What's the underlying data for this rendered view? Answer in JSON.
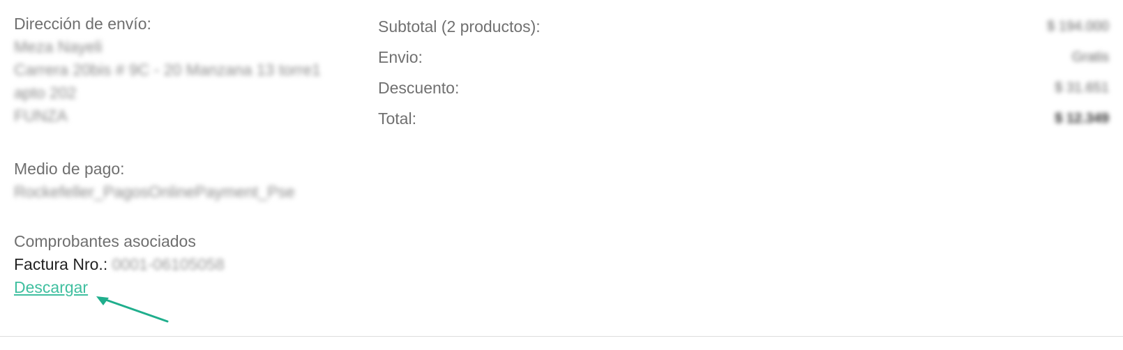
{
  "shipping": {
    "label": "Dirección de envío:",
    "lines": [
      "Meza Nayeli",
      "Carrera 20bis # 9C - 20 Manzana 13 torre1",
      "apto 202",
      "FUNZA"
    ]
  },
  "payment": {
    "label": "Medio de pago:",
    "method": "Rockefeller_PagosOnlinePayment_Pse"
  },
  "vouchers": {
    "label": "Comprobantes asociados",
    "invoice_label": "Factura Nro.:",
    "invoice_number": "0001-06105058",
    "download_label": "Descargar"
  },
  "summary": {
    "rows": [
      {
        "label": "Subtotal (2 productos):",
        "value": "$ 194.000"
      },
      {
        "label": "Envio:",
        "value": "Gratis"
      },
      {
        "label": "Descuento:",
        "value": "$ 31.651"
      },
      {
        "label": "Total:",
        "value": "$ 12.349"
      }
    ]
  },
  "colors": {
    "link": "#3fbf9f",
    "annotation_arrow": "#1fae8c"
  }
}
